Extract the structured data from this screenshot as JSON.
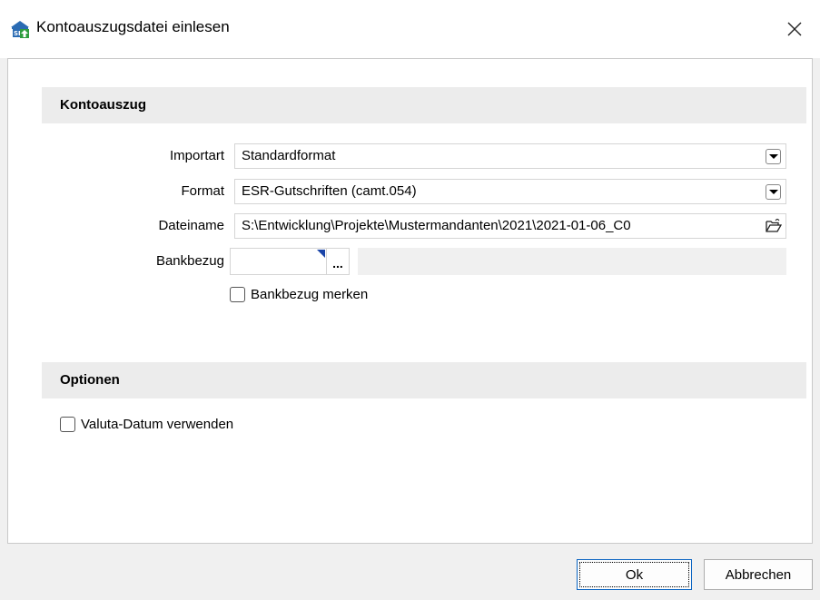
{
  "window": {
    "title": "Kontoauszugsdatei einlesen",
    "close_icon": "close-icon"
  },
  "sections": {
    "kontoauszug": "Kontoauszug",
    "optionen": "Optionen"
  },
  "form": {
    "importart": {
      "label": "Importart",
      "value": "Standardformat"
    },
    "format": {
      "label": "Format",
      "value": "ESR-Gutschriften (camt.054)"
    },
    "dateiname": {
      "label": "Dateiname",
      "value": "S:\\Entwicklung\\Projekte\\Mustermandanten\\2021\\2021-01-06_C0"
    },
    "bankbezug": {
      "label": "Bankbezug",
      "value": "",
      "browse_label": "..."
    },
    "bankbezug_merken": {
      "label": "Bankbezug merken",
      "checked": false
    }
  },
  "options": {
    "valuta": {
      "label": "Valuta-Datum verwenden",
      "checked": false
    }
  },
  "buttons": {
    "ok": "Ok",
    "cancel": "Abbrechen"
  }
}
